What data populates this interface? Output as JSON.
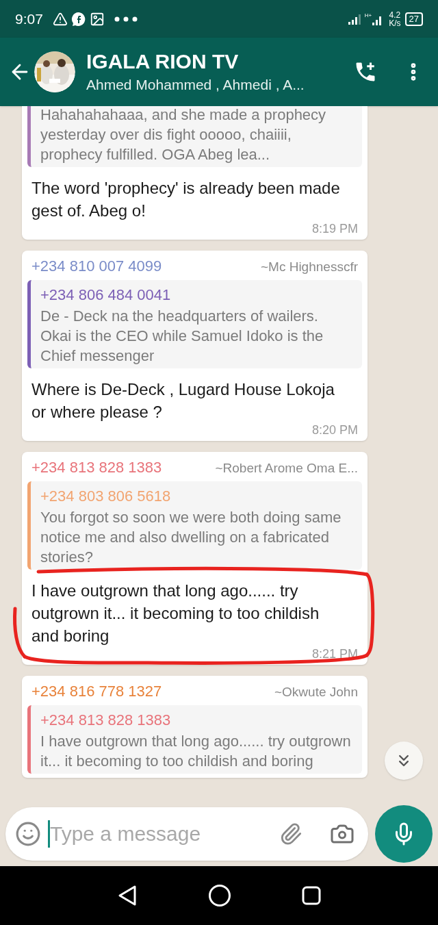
{
  "status_bar": {
    "time": "9:07",
    "network_type": "H+",
    "speed_value": "4.2",
    "speed_unit": "K/s",
    "battery": "27"
  },
  "header": {
    "title": "IGALA RION TV",
    "subtitle": "Ahmed Mohammed , Ahmedi , A..."
  },
  "messages": [
    {
      "quote": {
        "text": "Hahahahahaaa, and she made a prophecy yesterday over dis fight ooooo, chaiiii, prophecy fulfilled. OGA Abeg lea...",
        "color": "#a77ab5"
      },
      "body": "The word 'prophecy' is already been made gest of. Abeg o!",
      "time": "8:19 PM"
    },
    {
      "sender_phone": "+234 810 007 4099",
      "sender_name": "~Mc Highnesscfr",
      "color": "#7a8cc8",
      "quote": {
        "author": "+234 806 484 0041",
        "text": "De - Deck na the headquarters of wailers. Okai is the CEO while Samuel Idoko is the Chief messenger",
        "color": "#7c5fb5"
      },
      "body": "Where is De-Deck , Lugard House Lokoja or where please ?",
      "time": "8:20 PM"
    },
    {
      "sender_phone": "+234 813 828 1383",
      "sender_name": "~Robert Arome Oma E...",
      "color": "#e8737a",
      "quote": {
        "author": "+234 803 806 5618",
        "text": "You forgot so soon we were both doing same notice me and also dwelling on a fabricated stories?",
        "color": "#f2a470"
      },
      "body": "I have outgrown that long ago...... try outgrown it... it becoming to too childish and boring",
      "time": "8:21 PM"
    },
    {
      "sender_phone": "+234 816 778 1327",
      "sender_name": "~Okwute John",
      "color": "#e8823a",
      "quote": {
        "author": "+234 813 828 1383",
        "text": "I have outgrown that long ago...... try outgrown it... it becoming to too childish and boring",
        "color": "#e8737a"
      }
    }
  ],
  "composer": {
    "placeholder": "Type a message"
  }
}
